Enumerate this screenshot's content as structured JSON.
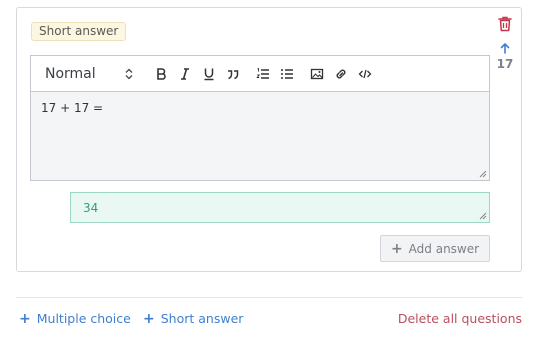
{
  "question": {
    "type_badge": "Short answer",
    "number": "17",
    "prompt_text": "17 + 17 =",
    "answer_value": "34",
    "format_select": "Normal",
    "toolbar_icons": [
      "bold-icon",
      "italic-icon",
      "underline-icon",
      "blockquote-icon",
      "ordered-list-icon",
      "bullet-list-icon",
      "image-icon",
      "link-icon",
      "code-icon"
    ],
    "add_answer_label": "Add answer"
  },
  "footer": {
    "add_multiple_choice": "Multiple choice",
    "add_short_answer": "Short answer",
    "delete_all": "Delete all questions"
  },
  "colors": {
    "delete": "#c2374d",
    "link": "#3f7fcf",
    "answer_bg": "#e9f8f2",
    "answer_text": "#2f9f78",
    "badge_bg": "#fcf7e3"
  }
}
